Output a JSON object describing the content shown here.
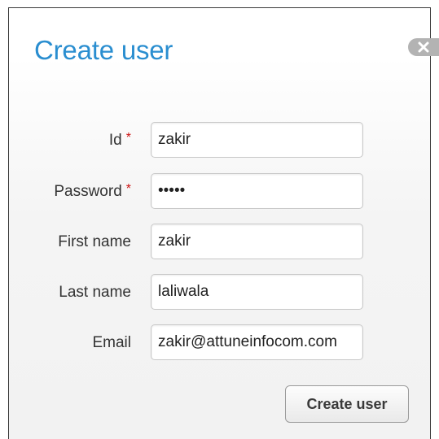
{
  "dialog": {
    "title": "Create user",
    "close_icon": "close-icon"
  },
  "form": {
    "fields": [
      {
        "label": "Id",
        "required": true,
        "value": "zakir",
        "type": "text"
      },
      {
        "label": "Password",
        "required": true,
        "value": "12345",
        "type": "password"
      },
      {
        "label": "First name",
        "required": false,
        "value": "zakir",
        "type": "text"
      },
      {
        "label": "Last name",
        "required": false,
        "value": "laliwala",
        "type": "text"
      },
      {
        "label": "Email",
        "required": false,
        "value": "zakir@attuneinfocom.com",
        "type": "text"
      }
    ],
    "required_marker": "*",
    "submit_label": "Create user"
  },
  "colors": {
    "title": "#2a8ed0",
    "required_marker": "#cc1111",
    "close_button": "#b3b3b3"
  }
}
